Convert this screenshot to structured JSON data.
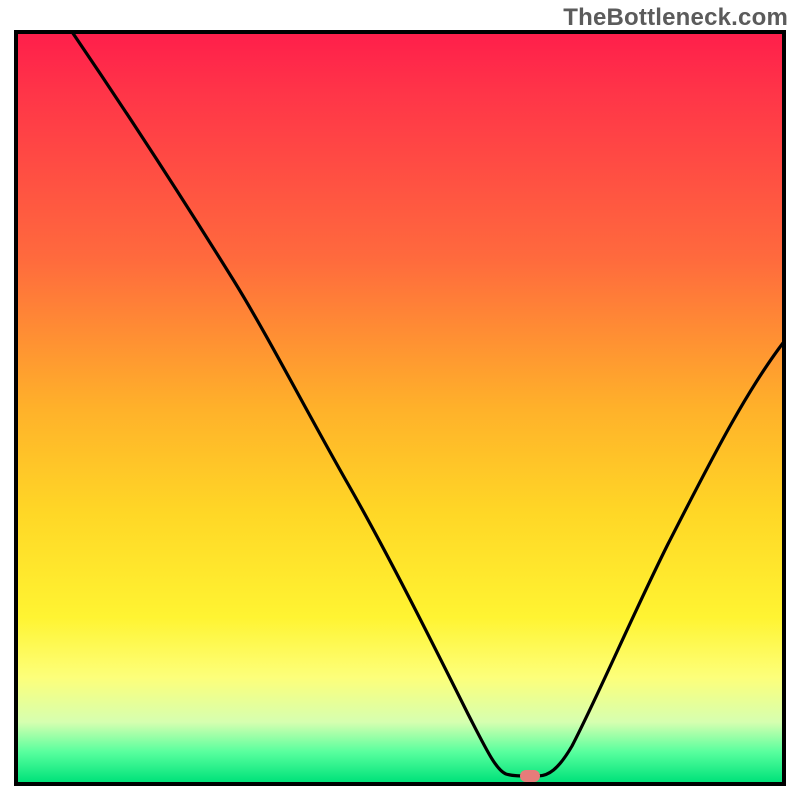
{
  "watermark": "TheBottleneck.com",
  "chart_data": {
    "type": "line",
    "title": "",
    "xlabel": "",
    "ylabel": "",
    "xlim": [
      0,
      100
    ],
    "ylim": [
      0,
      100
    ],
    "grid": false,
    "legend": false,
    "background": {
      "kind": "vertical-gradient",
      "meaning": "red (top) = high bottleneck, green (bottom) = optimal",
      "stops": [
        {
          "pos": 0.0,
          "color": "#ff1f4b"
        },
        {
          "pos": 0.5,
          "color": "#ffd726"
        },
        {
          "pos": 0.86,
          "color": "#fdff7a"
        },
        {
          "pos": 1.0,
          "color": "#00e27a"
        }
      ]
    },
    "series": [
      {
        "name": "bottleneck-curve",
        "x": [
          7,
          14,
          21,
          28,
          35,
          42,
          49,
          56,
          62,
          66,
          68,
          72,
          78,
          85,
          92,
          100
        ],
        "y": [
          100,
          89,
          78,
          66,
          55,
          42,
          29,
          17,
          6,
          1,
          0,
          2,
          12,
          25,
          40,
          58
        ]
      }
    ],
    "marker": {
      "name": "optimal-point",
      "x": 68,
      "y": 0,
      "color": "#e77c7a",
      "shape": "rounded-rect"
    }
  }
}
